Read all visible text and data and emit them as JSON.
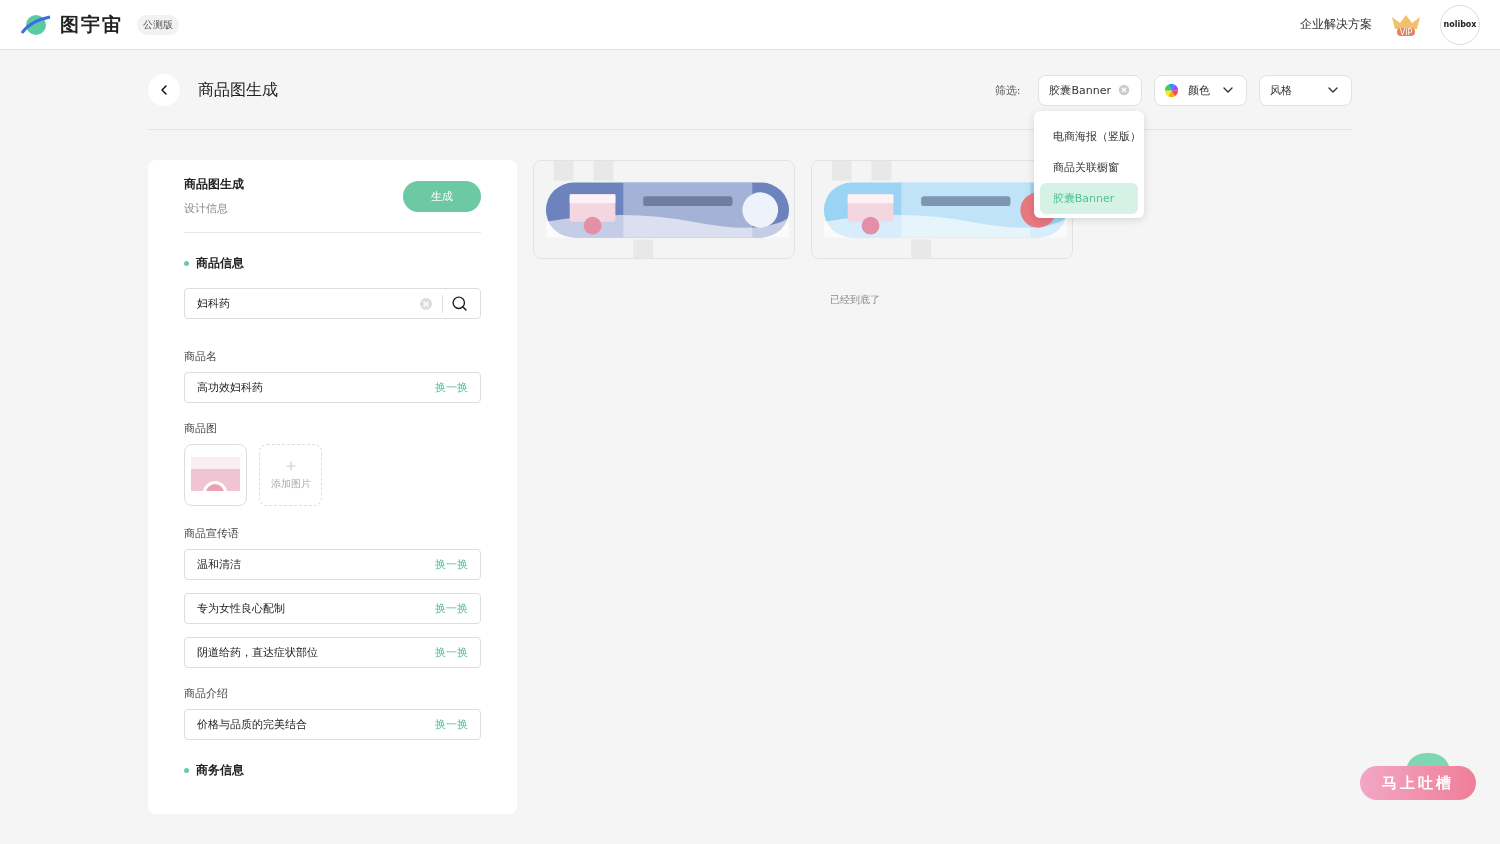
{
  "header": {
    "logo": "图宇宙",
    "badge": "公测版",
    "enterprise_link": "企业解决方案",
    "vip_label": "VIP",
    "avatar_text": "nolibox"
  },
  "page": {
    "title": "商品图生成"
  },
  "filters": {
    "label": "筛选:",
    "chips": [
      {
        "kind": "tag",
        "label": "胶囊Banner"
      },
      {
        "kind": "color",
        "label": "颜色"
      },
      {
        "kind": "select",
        "label": "风格"
      }
    ],
    "menu": [
      {
        "label": "电商海报（竖版）",
        "selected": false
      },
      {
        "label": "商品关联橱窗",
        "selected": false
      },
      {
        "label": "胶囊Banner",
        "selected": true
      }
    ]
  },
  "form": {
    "title": "商品图生成",
    "subtitle": "设计信息",
    "generate_button": "生成",
    "sections": [
      {
        "heading": "商品信息",
        "search": {
          "value": "妇科药"
        },
        "groups": [
          {
            "kind": "fields",
            "label": "商品名",
            "fields": [
              {
                "value": "高功效妇科药",
                "action": "换一换"
              }
            ]
          },
          {
            "kind": "images",
            "label": "商品图",
            "add_label": "添加图片"
          },
          {
            "kind": "fields",
            "label": "商品宣传语",
            "fields": [
              {
                "value": "温和清洁",
                "action": "换一换"
              },
              {
                "value": "专为女性良心配制",
                "action": "换一换"
              },
              {
                "value": "阴道给药，直达症状部位",
                "action": "换一换"
              }
            ]
          },
          {
            "kind": "fields",
            "label": "商品介绍",
            "fields": [
              {
                "value": "价格与品质的完美结合",
                "action": "换一换"
              }
            ]
          }
        ]
      },
      {
        "heading": "商务信息"
      }
    ]
  },
  "results": {
    "end_text": "已经到底了"
  },
  "feedback_button": "马上吐槽"
}
